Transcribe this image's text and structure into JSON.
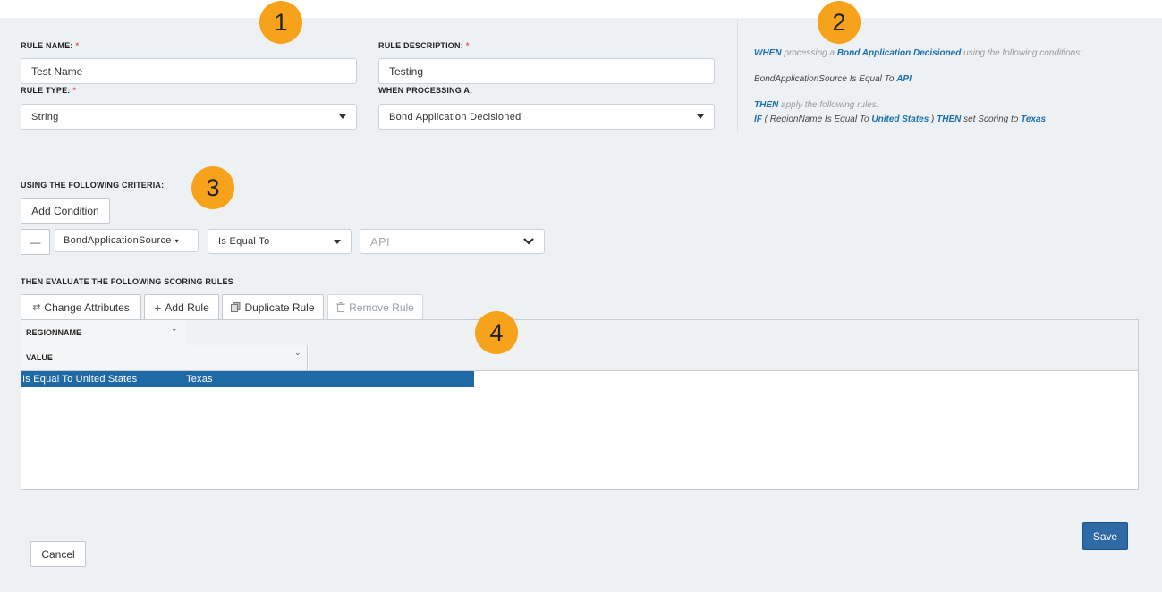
{
  "form": {
    "rule_name_label": "RULE NAME:",
    "rule_name_value": "Test Name",
    "rule_description_label": "RULE DESCRIPTION:",
    "rule_description_value": "Testing",
    "rule_type_label": "RULE TYPE:",
    "rule_type_value": "String",
    "when_processing_label": "WHEN PROCESSING A:",
    "when_processing_value": "Bond Application Decisioned",
    "required_mark": "*"
  },
  "summary": {
    "when_kw": "WHEN",
    "processing_a": " processing a ",
    "event": "Bond Application Decisioned",
    "using_conditions": " using the following conditions:",
    "condition_line": "BondApplicationSource Is Equal To ",
    "condition_value": "API",
    "then_kw": "THEN",
    "apply_rules": " apply the following rules:",
    "if_kw": "IF",
    "open_paren": " ( RegionName Is Equal To ",
    "region_value": "United States",
    "close_paren": " ) ",
    "then_kw2": "THEN",
    "set_scoring": " set Scoring to ",
    "scoring_value": "Texas"
  },
  "criteria": {
    "heading": "USING THE FOLLOWING CRITERIA:",
    "add_condition": "Add Condition",
    "remove_symbol": "—",
    "attribute": "BondApplicationSource",
    "operator": "Is Equal To",
    "value": "API"
  },
  "scoring": {
    "heading": "THEN EVALUATE THE FOLLOWING SCORING RULES",
    "change_attributes": "Change Attributes",
    "add_rule": "Add Rule",
    "duplicate_rule": "Duplicate Rule",
    "remove_rule": "Remove Rule",
    "col1_header": "REGIONNAME",
    "col2_header": "VALUE",
    "rows": [
      {
        "condition": "Is Equal To United States",
        "value": "Texas"
      }
    ]
  },
  "footer": {
    "cancel": "Cancel",
    "save": "Save"
  },
  "badges": [
    "1",
    "2",
    "3",
    "4"
  ],
  "colors": {
    "accent": "#1c6fb0",
    "badge": "#f7a21b",
    "selected_row": "#1f6aa5",
    "save_button": "#2d6aa6"
  }
}
